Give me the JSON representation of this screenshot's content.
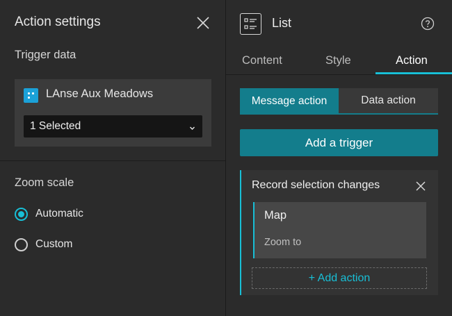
{
  "left_panel": {
    "title": "Action settings",
    "close_icon": "close-icon",
    "trigger_data": {
      "label": "Trigger data",
      "layer_icon": "layer-icon",
      "layer_name": "LAnse Aux Meadows",
      "selection_value": "1 Selected"
    },
    "zoom_scale": {
      "label": "Zoom scale",
      "options": [
        {
          "label": "Automatic",
          "checked": true
        },
        {
          "label": "Custom",
          "checked": false
        }
      ]
    }
  },
  "right_panel": {
    "widget_icon": "list-icon",
    "widget_name": "List",
    "help_icon": "help-icon",
    "tabs": [
      {
        "label": "Content",
        "active": false
      },
      {
        "label": "Style",
        "active": false
      },
      {
        "label": "Action",
        "active": true
      }
    ],
    "segments": [
      {
        "label": "Message action",
        "active": true
      },
      {
        "label": "Data action",
        "active": false
      }
    ],
    "add_trigger_label": "Add a trigger",
    "trigger": {
      "title": "Record selection changes",
      "action": {
        "target": "Map",
        "name": "Zoom to"
      },
      "add_action_label": "+ Add action"
    }
  },
  "colors": {
    "accent": "#18bfd6",
    "accent_dark": "#137d8c",
    "background": "#2b2b2b"
  }
}
